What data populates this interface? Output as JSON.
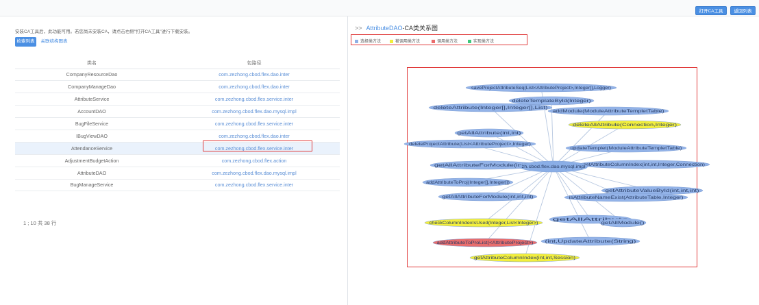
{
  "toolbar": {
    "open_ca_tool": "打开CA工具",
    "second_button": "返回列表"
  },
  "notice": "安装CA工具后，此功能可用。若您尚未安装CA，请点击右侧\"打开CA工具\"进行下载安装。",
  "tabs": {
    "active": "检索列表",
    "inactive": "关联结构图表"
  },
  "table": {
    "headers": [
      "类名",
      "包路径"
    ],
    "rows": [
      [
        "CompanyResourceDao",
        "com.zezhong.cbod.flex.dao.inter"
      ],
      [
        "CompanyManageDao",
        "com.zezhong.cbod.flex.dao.inter"
      ],
      [
        "AttributeService",
        "com.zezhong.cbod.flex.service.inter"
      ],
      [
        "AccountDAO",
        "com.zezhong.cbod.flex.dao.mysql.impl"
      ],
      [
        "BugFileService",
        "com.zezhong.cbod.flex.service.inter"
      ],
      [
        "IBugViewDAO",
        "com.zezhong.cbod.flex.dao.inter"
      ],
      [
        "AttendanceService",
        "com.zezhong.cbod.flex.service.inter"
      ],
      [
        "AdjustmentBudgetAction",
        "com.zezhong.cbod.flex.action"
      ],
      [
        "AttributeDAO",
        "com.zezhong.cbod.flex.dao.mysql.impl"
      ],
      [
        "BugManageService",
        "com.zezhong.cbod.flex.service.inter"
      ]
    ],
    "selected_index": 6
  },
  "pager": "1 ; 10 共 38 行",
  "graph": {
    "prefix": ">>",
    "title_class": "AttributeDAO",
    "title_suffix": "-CA类关系图",
    "legend": [
      {
        "label": "选择类方法",
        "color": "#8fb0e6"
      },
      {
        "label": "被调用类方法",
        "color": "#f2ee3a"
      },
      {
        "label": "调用类方法",
        "color": "#ea6a6a"
      },
      {
        "label": "实现类方法",
        "color": "#3ec87a"
      }
    ],
    "center": {
      "label": "com.zezhong.cbod.flex.dao.mysql.impl",
      "display": "zh.cbod.flex.dao.mysql.impl"
    },
    "nodes": [
      {
        "label": "saveProjectAttributeSeq(List<AttributeProject>,Integer[],Logger)",
        "role": "selected"
      },
      {
        "label": "deleteTemplateById(Integer)",
        "role": "selected"
      },
      {
        "label": "deleteAttribute(Integer[],Integer[],List)",
        "role": "selected"
      },
      {
        "label": "addModule(ModuleAttributeTempletTable)",
        "role": "selected"
      },
      {
        "label": "deleteAllAttribute(Connection,Integer)",
        "role": "called"
      },
      {
        "label": "getAllAttribute(int,int)",
        "role": "selected"
      },
      {
        "label": "deleteProjectAttribute(List<AttributeProject>,Integer)",
        "role": "selected"
      },
      {
        "label": "updateTemplet(ModuleAttributeTempletTable)",
        "role": "selected"
      },
      {
        "label": "getAllAttributeForModule(int,int)",
        "role": "selected"
      },
      {
        "label": "getAttributeColumnIndex(int,int,Integer,Connection)",
        "role": "selected"
      },
      {
        "label": "addAttributeToProj(Integer[],Integer[])",
        "role": "selected"
      },
      {
        "label": "getAttributeValueById(int,int,int)",
        "role": "selected"
      },
      {
        "label": "getAllAttributeForModule(int,int,int)",
        "role": "selected"
      },
      {
        "label": "isAttributeNameExist(AttributeTable,Integer)",
        "role": "selected"
      },
      {
        "label": "getAllAttribute",
        "role": "selected"
      },
      {
        "label": "getAllModule()",
        "role": "selected"
      },
      {
        "label": "checkColumnIndexIsUsed(Integer,List<Integer>)",
        "role": "called"
      },
      {
        "label": "addAttributeToProList(<AttributeProject>)",
        "role": "calling"
      },
      {
        "label": "(int,UpdateAttribute(String)",
        "role": "selected"
      },
      {
        "label": "getAttributeColumnIndex(int,int,Session)",
        "role": "called"
      }
    ]
  }
}
